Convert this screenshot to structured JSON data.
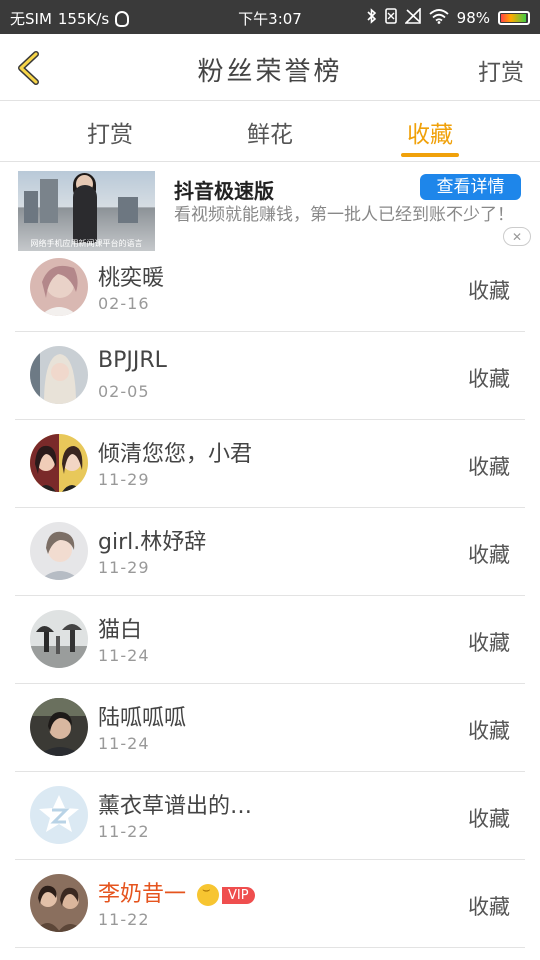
{
  "status_bar": {
    "carrier": "无SIM",
    "speed": "155K/s",
    "time": "下午3:07",
    "battery": "98%"
  },
  "header": {
    "back_icon": "chevron-left-icon",
    "title": "粉丝荣誉榜",
    "action": "打赏"
  },
  "tabs": [
    {
      "label": "打赏",
      "active": false
    },
    {
      "label": "鲜花",
      "active": false
    },
    {
      "label": "收藏",
      "active": true
    }
  ],
  "ad": {
    "thumb_caption": "网络手机应用新闻课平台的语言",
    "title": "抖音极速版",
    "description": "看视频就能赚钱，第一批人已经到账不少了！",
    "button": "查看详情",
    "close_icon": "close-icon"
  },
  "colors": {
    "accent": "#f0a10a",
    "ad_button": "#1e86ea",
    "vip_name": "#e5541e"
  },
  "fans": [
    {
      "name": "桃奕暖",
      "date": "02-16",
      "action": "收藏"
    },
    {
      "name": "BPJJRL",
      "date": "02-05",
      "action": "收藏"
    },
    {
      "name": "倾清您您，小君",
      "date": "11-29",
      "action": "收藏"
    },
    {
      "name": "girl.林妤辞",
      "date": "11-29",
      "action": "收藏"
    },
    {
      "name": "猫白",
      "date": "11-24",
      "action": "收藏"
    },
    {
      "name": "陆呱呱呱",
      "date": "11-24",
      "action": "收藏"
    },
    {
      "name": "薰衣草谱出的…",
      "date": "11-22",
      "action": "收藏"
    },
    {
      "name": "李奶昔一",
      "date": "11-22",
      "action": "收藏",
      "vip_label": "VIP"
    }
  ]
}
